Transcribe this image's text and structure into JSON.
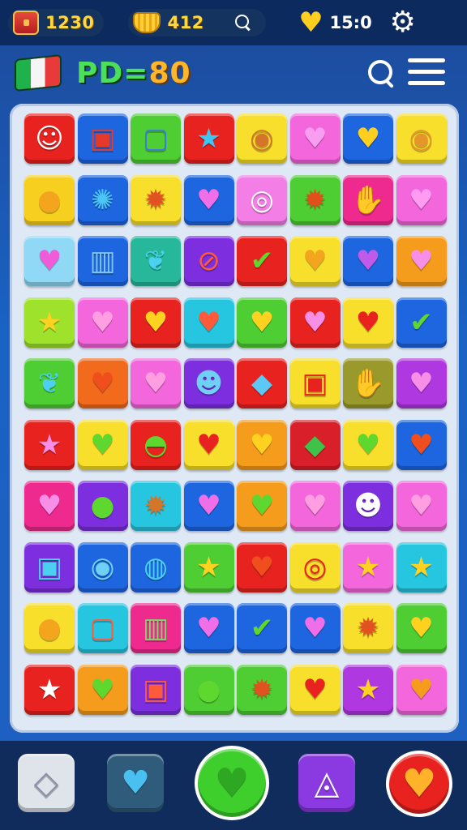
{
  "hud": {
    "chest_count": "1230",
    "coin_count": "412",
    "timer": "15:0",
    "icons": [
      "chest-icon",
      "coin-icon",
      "search-icon",
      "heart-icon",
      "gear-icon"
    ]
  },
  "level": {
    "title": "PD=",
    "number": "80",
    "icons": [
      "flag-icon",
      "search-icon",
      "menu-icon"
    ]
  },
  "board": {
    "rows": [
      [
        [
          "#e8231f",
          "face",
          "☺",
          "#ffffff"
        ],
        [
          "#1d66e0",
          "cup",
          "▣",
          "#e53a2b"
        ],
        [
          "#4fce34",
          "card",
          "▢",
          "#3a7be0"
        ],
        [
          "#e8231f",
          "star",
          "★",
          "#3fc6f0"
        ],
        [
          "#f7df2c",
          "pot",
          "◉",
          "#d5752a"
        ],
        [
          "#f466dc",
          "heart",
          "♥",
          "#f79ef0"
        ],
        [
          "#1d66e0",
          "heart",
          "♥",
          "#ffcf1f"
        ],
        [
          "#f7df2c",
          "basket",
          "◉",
          "#e5962a"
        ]
      ],
      [
        [
          "#f7cf1f",
          "orange",
          "●",
          "#f4a51e"
        ],
        [
          "#1d66e0",
          "ball",
          "✺",
          "#4cc5f5"
        ],
        [
          "#f7df2c",
          "sun",
          "✹",
          "#e0521f"
        ],
        [
          "#1d66e0",
          "heart",
          "♥",
          "#f06ee8"
        ],
        [
          "#f27ee6",
          "film",
          "◎",
          "#ffffff"
        ],
        [
          "#4fce34",
          "sun",
          "✹",
          "#e34f1c"
        ],
        [
          "#ef2a8e",
          "hand",
          "✋",
          "#ffd43a"
        ],
        [
          "#f466dc",
          "heart",
          "♥",
          "#ff9bf0"
        ]
      ],
      [
        [
          "#8fd9f7",
          "heart",
          "♥",
          "#f05bd9"
        ],
        [
          "#1d66e0",
          "jar",
          "▥",
          "#7fc6f5"
        ],
        [
          "#27b89c",
          "leaf",
          "❦",
          "#4ad1f0"
        ],
        [
          "#7d2fe0",
          "block",
          "⊘",
          "#ff5a3a"
        ],
        [
          "#e8231f",
          "leaf",
          "✔",
          "#5ed82f"
        ],
        [
          "#f7df2c",
          "heart",
          "♥",
          "#f4a51e"
        ],
        [
          "#1d66e0",
          "heart",
          "♥",
          "#c05be9"
        ],
        [
          "#f59c1c",
          "heart",
          "♥",
          "#f78fe8"
        ]
      ],
      [
        [
          "#9ee22c",
          "star",
          "★",
          "#ffd21f"
        ],
        [
          "#f466dc",
          "heart",
          "♥",
          "#ff9ee0"
        ],
        [
          "#e8231f",
          "heart",
          "♥",
          "#ffd21f"
        ],
        [
          "#27c6e0",
          "heart",
          "♥",
          "#ff5a3a"
        ],
        [
          "#4fce34",
          "heart",
          "♥",
          "#ffd21f"
        ],
        [
          "#e8231f",
          "heart",
          "♥",
          "#f78fe8"
        ],
        [
          "#f7df2c",
          "heart",
          "♥",
          "#e8231f"
        ],
        [
          "#1d66e0",
          "leaf",
          "✔",
          "#5ed82f"
        ]
      ],
      [
        [
          "#4fce34",
          "leaf",
          "❦",
          "#4ad1f0"
        ],
        [
          "#f26b1c",
          "heart",
          "♥",
          "#f04e1c"
        ],
        [
          "#f466dc",
          "heart",
          "♥",
          "#ff9ee0"
        ],
        [
          "#7d2fe0",
          "bear",
          "☻",
          "#6ed0f5"
        ],
        [
          "#e8231f",
          "gem",
          "◆",
          "#5bc8f5"
        ],
        [
          "#f7df2c",
          "box",
          "▣",
          "#e8231f"
        ],
        [
          "#9a9a2c",
          "glove",
          "✋",
          "#f78fe8"
        ],
        [
          "#b038e0",
          "heart",
          "♥",
          "#f78fe8"
        ]
      ],
      [
        [
          "#e8231f",
          "star",
          "★",
          "#f78fe8"
        ],
        [
          "#f7df2c",
          "heart",
          "♥",
          "#5ed82f"
        ],
        [
          "#e8231f",
          "cake",
          "◓",
          "#5ed82f"
        ],
        [
          "#f7df2c",
          "heart",
          "♥",
          "#e8231f"
        ],
        [
          "#f59c1c",
          "heart",
          "♥",
          "#ffd21f"
        ],
        [
          "#d81f2a",
          "gem",
          "◆",
          "#3fc24a"
        ],
        [
          "#f7df2c",
          "heart",
          "♥",
          "#5ed82f"
        ],
        [
          "#1d66e0",
          "heart",
          "♥",
          "#f04e1c"
        ]
      ],
      [
        [
          "#ef2a8e",
          "heart",
          "♥",
          "#f78fe8"
        ],
        [
          "#7d2fe0",
          "apple",
          "●",
          "#5ed82f"
        ],
        [
          "#27c6e0",
          "sun",
          "✹",
          "#d5752a"
        ],
        [
          "#1d66e0",
          "heart",
          "♥",
          "#f06ee8"
        ],
        [
          "#f59c1c",
          "heart",
          "♥",
          "#5ed82f"
        ],
        [
          "#f466dc",
          "heart",
          "♥",
          "#ff9ee0"
        ],
        [
          "#7d2fe0",
          "robot",
          "☻",
          "#ffffff"
        ],
        [
          "#f466dc",
          "heart",
          "♥",
          "#ff9ee0"
        ]
      ],
      [
        [
          "#7d2fe0",
          "tablet",
          "▣",
          "#4ad1f0"
        ],
        [
          "#1d66e0",
          "camera",
          "◉",
          "#6ed0f5"
        ],
        [
          "#1d66e0",
          "pan",
          "◍",
          "#4ad1f0"
        ],
        [
          "#4fce34",
          "star",
          "★",
          "#ffd21f"
        ],
        [
          "#e8231f",
          "heart",
          "♥",
          "#f04e1c"
        ],
        [
          "#f7df2c",
          "donut",
          "◎",
          "#e8231f"
        ],
        [
          "#f466dc",
          "star",
          "★",
          "#ffd21f"
        ],
        [
          "#27c6e0",
          "star",
          "★",
          "#ffd21f"
        ]
      ],
      [
        [
          "#f7df2c",
          "orange",
          "●",
          "#f4a51e"
        ],
        [
          "#27c6e0",
          "card",
          "▢",
          "#ff5a3a"
        ],
        [
          "#ef2a8e",
          "bucket",
          "▥",
          "#7fd66a"
        ],
        [
          "#1d66e0",
          "heart",
          "♥",
          "#f06ee8"
        ],
        [
          "#1d66e0",
          "leaf",
          "✔",
          "#5ed82f"
        ],
        [
          "#1d66e0",
          "heart",
          "♥",
          "#f06ee8"
        ],
        [
          "#f7df2c",
          "sun",
          "✹",
          "#e0521f"
        ],
        [
          "#4fce34",
          "heart",
          "♥",
          "#ffd21f"
        ]
      ],
      [
        [
          "#e8231f",
          "star",
          "★",
          "#ffffff"
        ],
        [
          "#f59c1c",
          "heart",
          "♥",
          "#5ed82f"
        ],
        [
          "#7d2fe0",
          "box",
          "▣",
          "#ff5a3a"
        ],
        [
          "#4fce34",
          "leaf",
          "●",
          "#5ed82f"
        ],
        [
          "#4fce34",
          "sun",
          "✹",
          "#e0521f"
        ],
        [
          "#f7df2c",
          "heart",
          "♥",
          "#e8231f"
        ],
        [
          "#b038e0",
          "star",
          "★",
          "#ffd21f"
        ],
        [
          "#f466dc",
          "heart",
          "♥",
          "#f59c1c"
        ]
      ]
    ]
  },
  "actions": [
    {
      "name": "diamond-button",
      "glyph": "◇",
      "bg": "#dfe4ea",
      "fg": "#8a93a6",
      "shape": "rounded"
    },
    {
      "name": "shield-button",
      "glyph": "♥",
      "bg": "#2f5c7a",
      "fg": "#4ac0f0",
      "shape": "rounded"
    },
    {
      "name": "heart-play-button",
      "glyph": "♥",
      "bg": "#3ecf2c",
      "fg": "#2ea823",
      "shape": "circle"
    },
    {
      "name": "flask-button",
      "glyph": "◬",
      "bg": "#8a3ae0",
      "fg": "#ffffff",
      "shape": "rounded"
    },
    {
      "name": "heart-power-button",
      "glyph": "♥",
      "bg": "#e8231f",
      "fg": "#ffb22a",
      "shape": "circle"
    }
  ]
}
